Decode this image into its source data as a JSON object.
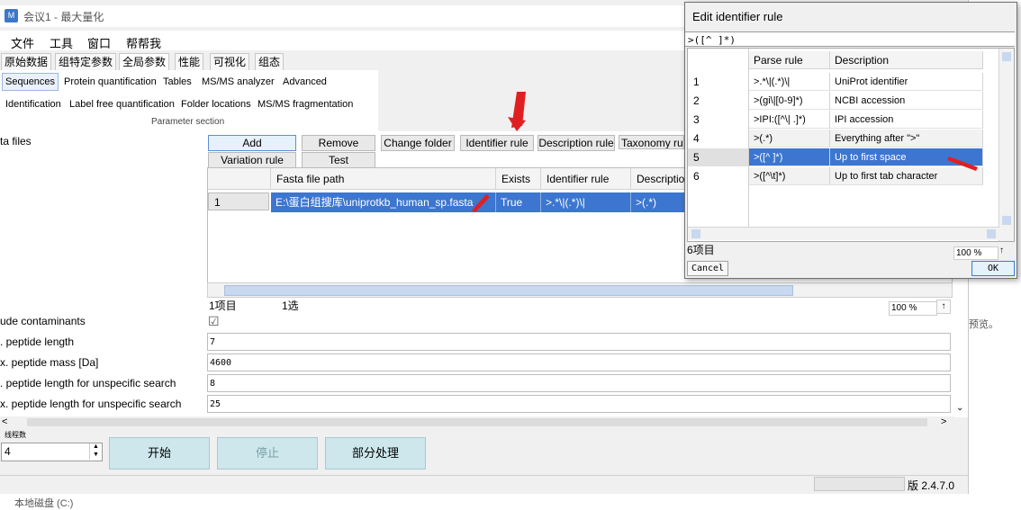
{
  "main_window": {
    "title": "会议1 - 最大量化",
    "menu": [
      "文件",
      "工具",
      "窗口",
      "帮帮我"
    ],
    "tabs": [
      "原始数据",
      "组特定参数",
      "全局参数",
      "性能",
      "可视化",
      "组态"
    ],
    "subtabs_row1": [
      "Sequences",
      "Protein quantification",
      "Tables",
      "MS/MS analyzer",
      "Advanced"
    ],
    "subtabs_row2": [
      "Identification",
      "Label free quantification",
      "Folder locations",
      "MS/MS fragmentation"
    ],
    "section_label": "Parameter section",
    "fasta_label": "ta files",
    "buttons_row1": [
      "Add",
      "Remove",
      "Change folder",
      "Identifier rule",
      "Description rule",
      "Taxonomy rule"
    ],
    "buttons_row2": [
      "Variation rule",
      "Test"
    ],
    "grid": {
      "columns": [
        "Fasta file path",
        "Exists",
        "Identifier rule",
        "Description"
      ],
      "row_number": "1",
      "row": [
        "E:\\蛋白组搜库\\uniprotkb_human_sp.fasta",
        "True",
        ">.*\\|(.*)\\|",
        ">(.*)"
      ]
    },
    "grid_footer": {
      "count": "1项目",
      "selected": "1选"
    },
    "zoom": "100 %",
    "params": [
      {
        "label": "ude contaminants",
        "value": "☑"
      },
      {
        "label": ". peptide length",
        "value": "7"
      },
      {
        "label": "x. peptide mass [Da]",
        "value": "4600"
      },
      {
        "label": ". peptide length for unspecific search",
        "value": "8"
      },
      {
        "label": "x. peptide length for unspecific search",
        "value": "25"
      }
    ],
    "threads_label": "线程数",
    "threads_value": "4",
    "actions": [
      "开始",
      "停止",
      "部分处理"
    ],
    "version": "版 2.4.7.0",
    "bottom_cut": "本地磁盘 (C:)",
    "right_edge_text": "预览。"
  },
  "dialog": {
    "title": "Edit identifier rule",
    "input_value": ">([^ ]*)",
    "columns": [
      "Parse rule",
      "Description"
    ],
    "rows": [
      {
        "n": "1",
        "rule": ">.*\\|(.*)\\|",
        "desc": "UniProt identifier"
      },
      {
        "n": "2",
        "rule": ">(gi\\|[0-9]*)",
        "desc": "NCBI accession"
      },
      {
        "n": "3",
        "rule": ">IPI:([^\\| .]*)",
        "desc": "IPI accession"
      },
      {
        "n": "4",
        "rule": ">(.*)",
        "desc": "Everything after \">\""
      },
      {
        "n": "5",
        "rule": ">([^ ]*)",
        "desc": "Up to first space"
      },
      {
        "n": "6",
        "rule": ">([^\\t]*)",
        "desc": "Up to first tab character"
      }
    ],
    "count": "6项目",
    "zoom": "100 %",
    "cancel": "Cancel",
    "ok": "OK"
  },
  "colors": {
    "selection": "#3c76d0",
    "arrow": "#e02020",
    "action_button": "#cde7ec"
  }
}
